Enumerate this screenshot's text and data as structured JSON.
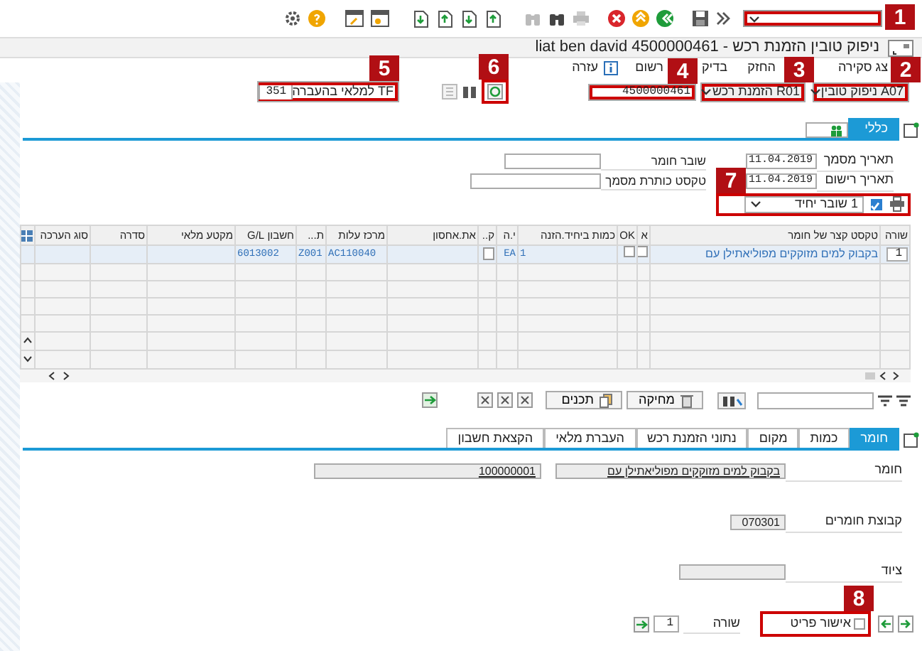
{
  "toolbar": {
    "command_field": {
      "callout": "1"
    }
  },
  "title": "ניפוק טובין הזמנת רכש - 4500000461 liat ben david",
  "menu": [
    "צג סקירה",
    "החזק",
    "בדיק",
    "רשום",
    "עזרה"
  ],
  "header": {
    "action": {
      "value": "A07 ניפוק טובין",
      "callout": "2"
    },
    "reference": {
      "value": "R01 הזמנת רכש",
      "callout": "3"
    },
    "po_number": {
      "value": "4500000461",
      "callout": "4"
    },
    "refresh_callout": "6",
    "movement": {
      "value": "TF למלאי בהעברה",
      "code": "351",
      "callout": "5"
    }
  },
  "header_tabs": [
    {
      "label": "כללי",
      "selected": true
    }
  ],
  "general": {
    "fields": [
      {
        "label": "תאריך מסמך",
        "value": "11.04.2019"
      },
      {
        "label": "תאריך רישום",
        "value": "11.04.2019"
      }
    ],
    "side_fields": [
      {
        "label": "שובר חומר"
      },
      {
        "label": "טקסט כותרת מסמך"
      }
    ],
    "print_checked": true,
    "voucher": {
      "value": "1 שובר יחיד",
      "callout": "7"
    }
  },
  "table": {
    "columns": [
      "שורה",
      "טקסט קצר של חומר",
      "א",
      "OK",
      "כמות ביחיד.הזנה",
      "י.ה",
      "ק..",
      "את.אחסון",
      "מרכז עלות",
      "ת...",
      "חשבון G/L",
      "מקטע מלאי",
      "סדרה",
      "סוג הערכה"
    ],
    "rows": [
      {
        "line": "1",
        "text": "בקבוק למים מזוקקים מפוליאתילן עם",
        "deleted": false,
        "ok": false,
        "qty": "1",
        "unit": "EA",
        "cost_center": "AC110040",
        "type": "Z001",
        "gl": "6013002"
      }
    ]
  },
  "table_toolbar": {
    "buttons": [
      "מחיקה",
      "תכנים"
    ]
  },
  "detail_tabs": [
    {
      "label": "חומר",
      "selected": true
    },
    {
      "label": "כמות",
      "selected": false
    },
    {
      "label": "מקום",
      "selected": false
    },
    {
      "label": "נתוני הזמנת רכש",
      "selected": false
    },
    {
      "label": "העברת מלאי",
      "selected": false
    },
    {
      "label": "הקצאת חשבון",
      "selected": false
    }
  ],
  "detail": {
    "material_label": "חומר",
    "material_name": "בקבוק למים מזוקקים מפוליאתילן עם",
    "material_number": "100000001",
    "group_label": "קבוצת חומרים",
    "group": "070301",
    "equipment_label": "ציוד"
  },
  "footer": {
    "item_ok": {
      "label": "אישור פריט",
      "checked": false,
      "callout": "8"
    },
    "line_label": "שורה",
    "line": "1"
  }
}
